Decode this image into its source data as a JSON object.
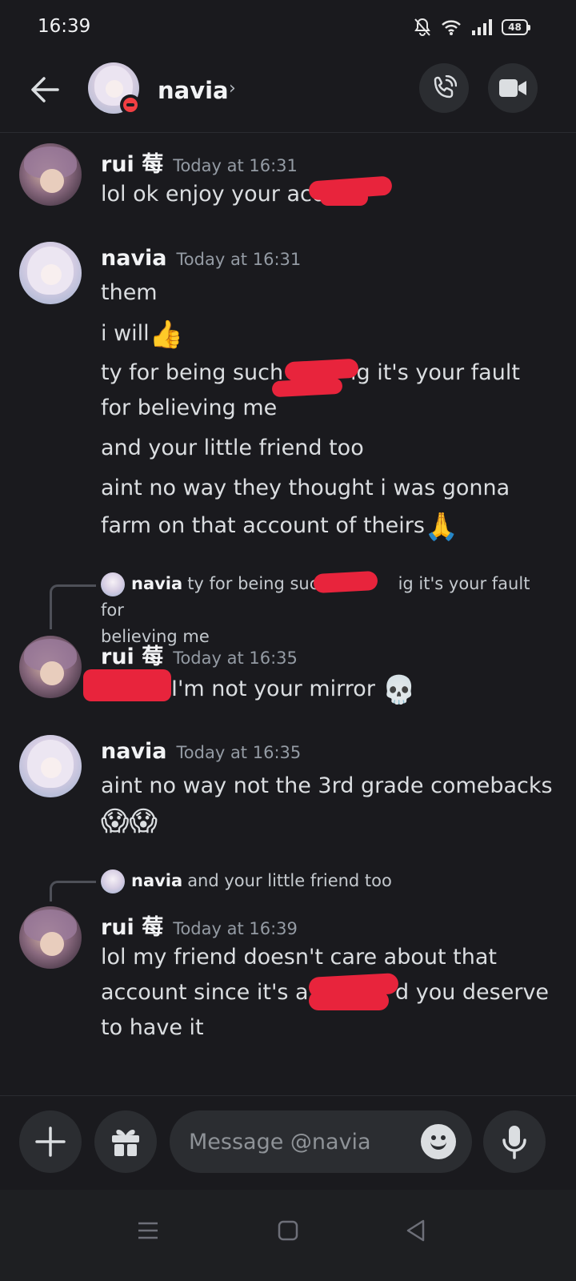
{
  "status_bar": {
    "time": "16:39",
    "battery": "48"
  },
  "header": {
    "contact_name": "navia",
    "chevron": "›"
  },
  "messages": [
    {
      "author": "rui 莓",
      "timestamp": "Today at 16:31",
      "lines": [
        "lol ok enjoy your acc"
      ]
    },
    {
      "author": "navia",
      "timestamp": "Today at 16:31",
      "lines": [
        "them",
        "i will",
        "ty for being such a",
        "ig it's your fault",
        "for believing me",
        "and your little friend too",
        "aint no way they thought i was gonna",
        "farm on that account of theirs"
      ],
      "emoji_thumbs": "👍",
      "emoji_pray": "🙏"
    },
    {
      "reply_to": {
        "author": "navia",
        "text_a": "ty for being such",
        "text_b": "ig it's your fault for",
        "text_c": "believing me"
      },
      "author": "rui 莓",
      "timestamp": "Today at 16:35",
      "lines": [
        "I'm not your mirror"
      ],
      "emoji_skull": "💀"
    },
    {
      "author": "navia",
      "timestamp": "Today at 16:35",
      "lines": [
        "aint no way not the 3rd grade comebacks"
      ],
      "emoji_scream": "😱😱"
    },
    {
      "reply_to": {
        "author": "navia",
        "text": "and your little friend too"
      },
      "author": "rui 莓",
      "timestamp": "Today at 16:39",
      "lines": [
        "lol my friend doesn't care about that",
        "account since it's a",
        "d you deserve",
        "to have it"
      ]
    }
  ],
  "composer": {
    "placeholder": "Message @navia"
  },
  "icons": [
    "back-arrow-icon",
    "phone-icon",
    "video-camera-icon",
    "plus-icon",
    "gift-icon",
    "smiley-icon",
    "microphone-icon",
    "menu-icon",
    "home-square-icon",
    "back-triangle-icon",
    "bell-muted-icon",
    "wifi-icon",
    "signal-icon",
    "battery-icon"
  ],
  "colors": {
    "background": "#1a1a1e",
    "redaction": "#e8243c",
    "dnd": "#f23f43"
  }
}
